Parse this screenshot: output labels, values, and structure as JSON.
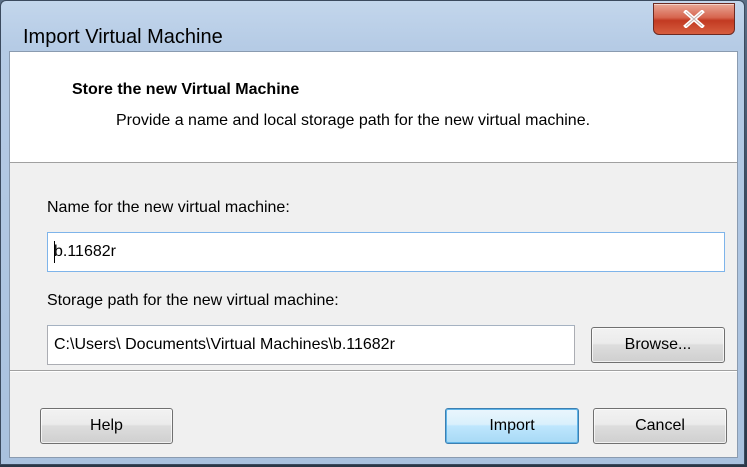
{
  "window": {
    "title": "Import Virtual Machine"
  },
  "header": {
    "title": "Store the new Virtual Machine",
    "description": "Provide a name and local storage path for the new virtual machine."
  },
  "form": {
    "name_label": "Name for the new virtual machine:",
    "name_value": "b.11682r",
    "path_label": "Storage path for the new virtual machine:",
    "path_value": "C:\\Users\\ Documents\\Virtual Machines\\b.11682r"
  },
  "buttons": {
    "browse": "Browse...",
    "help": "Help",
    "import": "Import",
    "cancel": "Cancel"
  },
  "icons": {
    "close": "close-icon"
  },
  "colors": {
    "close_button": "#c23a22",
    "default_button_border": "#3c7fb1",
    "focused_input_border": "#7eb4ea"
  }
}
